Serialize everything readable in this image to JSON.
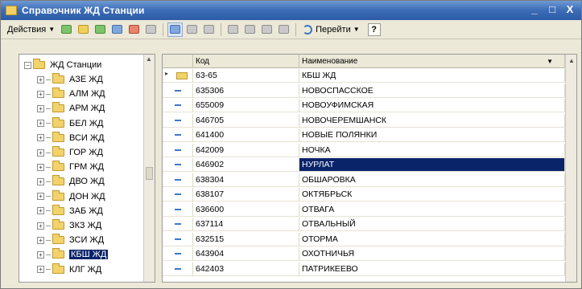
{
  "window": {
    "title": "Справочник ЖД Станции",
    "controls": [
      "_",
      "□",
      "X"
    ]
  },
  "toolbar": {
    "actions_label": "Действия",
    "goto_label": "Перейти",
    "help_label": "?"
  },
  "tree": {
    "root_label": "ЖД Станции",
    "items": [
      {
        "label": "АЗЕ ЖД",
        "selected": false
      },
      {
        "label": "АЛМ ЖД",
        "selected": false
      },
      {
        "label": "АРМ ЖД",
        "selected": false
      },
      {
        "label": "БЕЛ ЖД",
        "selected": false
      },
      {
        "label": "ВСИ ЖД",
        "selected": false
      },
      {
        "label": "ГОР ЖД",
        "selected": false
      },
      {
        "label": "ГРМ ЖД",
        "selected": false
      },
      {
        "label": "ДВО ЖД",
        "selected": false
      },
      {
        "label": "ДОН ЖД",
        "selected": false
      },
      {
        "label": "ЗАБ ЖД",
        "selected": false
      },
      {
        "label": "ЗКЗ ЖД",
        "selected": false
      },
      {
        "label": "ЗСИ ЖД",
        "selected": false
      },
      {
        "label": "КБШ ЖД",
        "selected": true
      },
      {
        "label": "КЛГ ЖД",
        "selected": false
      }
    ]
  },
  "grid": {
    "columns": [
      "Код",
      "Наименование"
    ],
    "rows": [
      {
        "code": "63-65",
        "name": "КБШ ЖД",
        "kind": "folder",
        "selected": false
      },
      {
        "code": "635306",
        "name": "НОВОСПАССКОЕ",
        "kind": "item",
        "selected": false
      },
      {
        "code": "655009",
        "name": "НОВОУФИМСКАЯ",
        "kind": "item",
        "selected": false
      },
      {
        "code": "646705",
        "name": "НОВОЧЕРЕМШАНСК",
        "kind": "item",
        "selected": false
      },
      {
        "code": "641400",
        "name": "НОВЫЕ ПОЛЯНКИ",
        "kind": "item",
        "selected": false
      },
      {
        "code": "642009",
        "name": "НОЧКА",
        "kind": "item",
        "selected": false
      },
      {
        "code": "646902",
        "name": "НУРЛАТ",
        "kind": "item",
        "selected": true
      },
      {
        "code": "638304",
        "name": "ОБШАРОВКА",
        "kind": "item",
        "selected": false
      },
      {
        "code": "638107",
        "name": "ОКТЯБРЬСК",
        "kind": "item",
        "selected": false
      },
      {
        "code": "636600",
        "name": "ОТВАГА",
        "kind": "item",
        "selected": false
      },
      {
        "code": "637114",
        "name": "ОТВАЛЬНЫЙ",
        "kind": "item",
        "selected": false
      },
      {
        "code": "632515",
        "name": "ОТОРМА",
        "kind": "item",
        "selected": false
      },
      {
        "code": "643904",
        "name": "ОХОТНИЧЬЯ",
        "kind": "item",
        "selected": false
      },
      {
        "code": "642403",
        "name": "ПАТРИКЕЕВО",
        "kind": "item",
        "selected": false
      }
    ]
  }
}
